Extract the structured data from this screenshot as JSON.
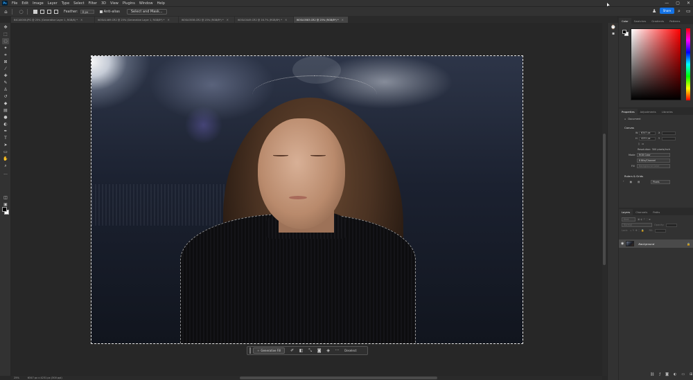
{
  "menu": [
    "File",
    "Edit",
    "Image",
    "Layer",
    "Type",
    "Select",
    "Filter",
    "3D",
    "View",
    "Plugins",
    "Window",
    "Help"
  ],
  "app_logo": "Ps",
  "window_controls": [
    "—",
    "▢",
    "✕"
  ],
  "options": {
    "feather_label": "Feather:",
    "feather_value": "0 px",
    "antialias_label": "Anti-alias",
    "select_mask_label": "Select and Mask..."
  },
  "share_label": "Share",
  "tabs": [
    {
      "title": "64C40000.JPG @ 25% (Generative Layer 1, RGB/8) *"
    },
    {
      "title": "IKOSA1469.CR2 @ 25% (Generative Layer 1, RGB/8*) *"
    },
    {
      "title": "IKOSA3538.CR2 @ 25% (RGB/8*) *"
    },
    {
      "title": "IKOSA3449.CR2 @ 16.7% (RGB/8*) *"
    },
    {
      "title": "IKOSA3583.CR2 @ 25% (RGB/8*) *"
    }
  ],
  "context_bar": {
    "generative_fill": "Generative Fill",
    "more": "···",
    "deselect": "Deselect"
  },
  "status": {
    "zoom": "25%",
    "doc_info": "6347 px x 4231 px (300 ppi)"
  },
  "color_panel": {
    "tabs": [
      "Color",
      "Swatches",
      "Gradients",
      "Patterns"
    ]
  },
  "properties_panel": {
    "tabs": [
      "Properties",
      "Adjustments",
      "Libraries"
    ],
    "doc_label": "Document",
    "canvas_title": "Canvas",
    "w_label": "W",
    "w_value": "6347 px",
    "x_label": "X",
    "h_label": "H",
    "h_value": "4231 px",
    "y_label": "Y",
    "resolution": "Resolution: 300 pixels/inch",
    "mode_label": "Mode",
    "mode_value": "RGB Color",
    "depth_value": "8 Bits/Channel",
    "fill_label": "Fill",
    "fill_value": "Background Color",
    "rulers_title": "Rulers & Grids",
    "units_value": "Pixels"
  },
  "layers_panel": {
    "tabs": [
      "Layers",
      "Channels",
      "Paths"
    ],
    "kind_label": "Kind",
    "blend_mode": "Normal",
    "opacity_label": "Opacity:",
    "lock_label": "Lock:",
    "fill_label": "Fill:",
    "layer_name": "Background"
  }
}
